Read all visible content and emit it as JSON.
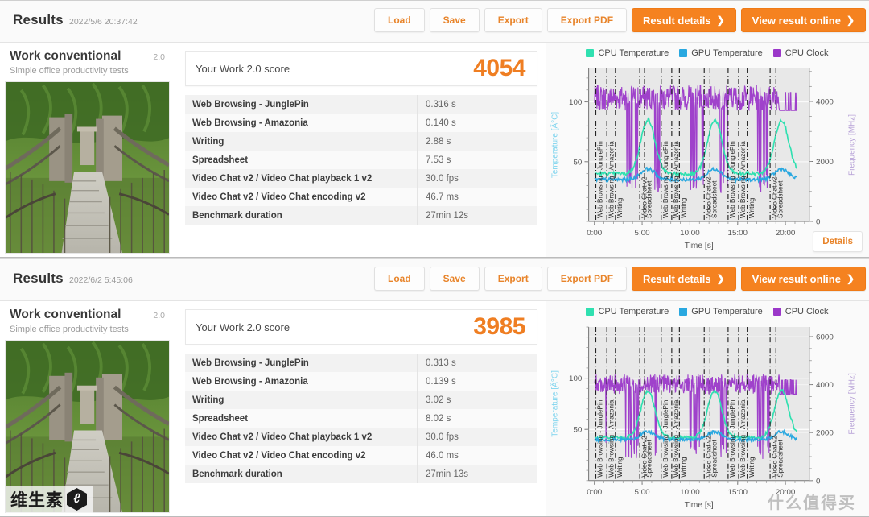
{
  "panels": [
    {
      "header": {
        "title": "Results",
        "date": "2022/5/6 20:37:42",
        "buttons": {
          "load": "Load",
          "save": "Save",
          "export": "Export",
          "export_pdf": "Export PDF",
          "result_details": "Result details",
          "view_online": "View result online",
          "chevron": "❯"
        }
      },
      "test": {
        "name": "Work conventional",
        "subtitle": "Simple office productivity tests",
        "version": "2.0"
      },
      "score": {
        "label": "Your Work 2.0 score",
        "value": "4054"
      },
      "rows": [
        {
          "k": "Web Browsing - JunglePin",
          "v": "0.316 s"
        },
        {
          "k": "Web Browsing - Amazonia",
          "v": "0.140 s"
        },
        {
          "k": "Writing",
          "v": "2.88 s"
        },
        {
          "k": "Spreadsheet",
          "v": "7.53 s"
        },
        {
          "k": "Video Chat v2 / Video Chat playback 1 v2",
          "v": "30.0 fps"
        },
        {
          "k": "Video Chat v2 / Video Chat encoding v2",
          "v": "46.7 ms"
        },
        {
          "k": "Benchmark duration",
          "v": "27min 12s"
        }
      ],
      "details_button": "Details",
      "chart_ref": 0
    },
    {
      "header": {
        "title": "Results",
        "date": "2022/6/2 5:45:06",
        "buttons": {
          "load": "Load",
          "save": "Save",
          "export": "Export",
          "export_pdf": "Export PDF",
          "result_details": "Result details",
          "view_online": "View result online",
          "chevron": "❯"
        }
      },
      "test": {
        "name": "Work conventional",
        "subtitle": "Simple office productivity tests",
        "version": "2.0"
      },
      "score": {
        "label": "Your Work 2.0 score",
        "value": "3985"
      },
      "rows": [
        {
          "k": "Web Browsing - JunglePin",
          "v": "0.313 s"
        },
        {
          "k": "Web Browsing - Amazonia",
          "v": "0.139 s"
        },
        {
          "k": "Writing",
          "v": "3.02 s"
        },
        {
          "k": "Spreadsheet",
          "v": "8.02 s"
        },
        {
          "k": "Video Chat v2 / Video Chat playback 1 v2",
          "v": "30.0 fps"
        },
        {
          "k": "Video Chat v2 / Video Chat encoding v2",
          "v": "46.0 ms"
        },
        {
          "k": "Benchmark duration",
          "v": "27min 13s"
        }
      ],
      "details_button": "",
      "chart_ref": 1
    }
  ],
  "watermark": {
    "text": "维生素",
    "logo_letter": "ℓ"
  },
  "watermark2": {
    "text": "什么值得买",
    "small": "值"
  },
  "colors": {
    "accent_orange": "#f58220",
    "score_orange": "#ef7e22",
    "cpu_temp": "#2fe0b0",
    "gpu_temp": "#29a8e0",
    "cpu_clock": "#9b38c9",
    "left_axis": "#59c7e8",
    "right_axis": "#a98fd0"
  },
  "chart_data": [
    {
      "type": "line",
      "title": "",
      "xlabel": "Time [s]",
      "ylabel_left": "Temperature [Â°C]",
      "ylabel_right": "Frequency [MHz]",
      "xticks": [
        "0:00",
        "5:00",
        "10:00",
        "15:00",
        "20:00"
      ],
      "xtick_values": [
        0,
        5,
        10,
        15,
        20
      ],
      "xlim": [
        -0.6,
        22.5
      ],
      "left_yticks": [
        50,
        100
      ],
      "left_ylim": [
        0,
        128
      ],
      "right_yticks": [
        0,
        2000,
        4000
      ],
      "right_ylim": [
        0,
        5100
      ],
      "grid": true,
      "legend_position": "top-center",
      "legend": [
        "CPU Temperature",
        "GPU Temperature",
        "CPU Clock"
      ],
      "annotations": [
        "Web Browsing - JunglePin",
        "Web Browsing - Amazonia",
        "Writing",
        "Video Chat v2",
        "Spreadsheet",
        "Web Browsing - JunglePin",
        "Web Browsing - Amazonia",
        "Writing",
        "Video Chat v2",
        "Spreadsheet",
        "Web Browsing - JunglePin",
        "Web Browsing - Amazonia",
        "Writing",
        "Video Chat v2",
        "Spreadsheet"
      ],
      "marker_times": [
        0.15,
        1.3,
        2.2,
        4.75,
        5.25,
        7.0,
        8.1,
        8.9,
        11.5,
        12.1,
        14.0,
        15.1,
        16.0,
        18.4,
        19.0
      ],
      "series": [
        {
          "name": "CPU Temperature",
          "color": "#2fe0b0",
          "axis": "left",
          "peak": 85,
          "base": 40
        },
        {
          "name": "GPU Temperature",
          "color": "#29a8e0",
          "axis": "left",
          "peak": 55,
          "base": 35
        },
        {
          "name": "CPU Clock",
          "color": "#9b38c9",
          "axis": "right",
          "peak": 4500,
          "base": 3700
        }
      ]
    },
    {
      "type": "line",
      "title": "",
      "xlabel": "Time [s]",
      "ylabel_left": "Temperature [Â°C]",
      "ylabel_right": "Frequency [MHz]",
      "xticks": [
        "0:00",
        "5:00",
        "10:00",
        "15:00",
        "20:00"
      ],
      "xtick_values": [
        0,
        5,
        10,
        15,
        20
      ],
      "xlim": [
        -0.6,
        22.5
      ],
      "left_yticks": [
        50,
        100
      ],
      "left_ylim": [
        0,
        150
      ],
      "right_yticks": [
        0,
        2000,
        4000,
        6000
      ],
      "right_ylim": [
        0,
        6400
      ],
      "grid": true,
      "legend_position": "top-center",
      "legend": [
        "CPU Temperature",
        "GPU Temperature",
        "CPU Clock"
      ],
      "annotations": [
        "Web Browsing - JunglePin",
        "Web Browsing - Amazonia",
        "Writing",
        "Video Chat v2",
        "Spreadsheet",
        "Web Browsing - JunglePin",
        "Web Browsing - Amazonia",
        "Writing",
        "Video Chat v2",
        "Spreadsheet",
        "Web Browsing - JunglePin",
        "Web Browsing - Amazonia",
        "Writing",
        "Video Chat v2",
        "Spreadsheet"
      ],
      "marker_times": [
        0.15,
        1.3,
        2.2,
        4.75,
        5.25,
        7.0,
        8.1,
        8.9,
        11.5,
        12.1,
        14.0,
        15.1,
        16.0,
        18.4,
        19.0
      ],
      "series": [
        {
          "name": "CPU Temperature",
          "color": "#2fe0b0",
          "axis": "left",
          "peak": 88,
          "base": 42
        },
        {
          "name": "GPU Temperature",
          "color": "#29a8e0",
          "axis": "left",
          "peak": 57,
          "base": 40
        },
        {
          "name": "CPU Clock",
          "color": "#9b38c9",
          "axis": "right",
          "peak": 4400,
          "base": 3600
        }
      ]
    }
  ]
}
